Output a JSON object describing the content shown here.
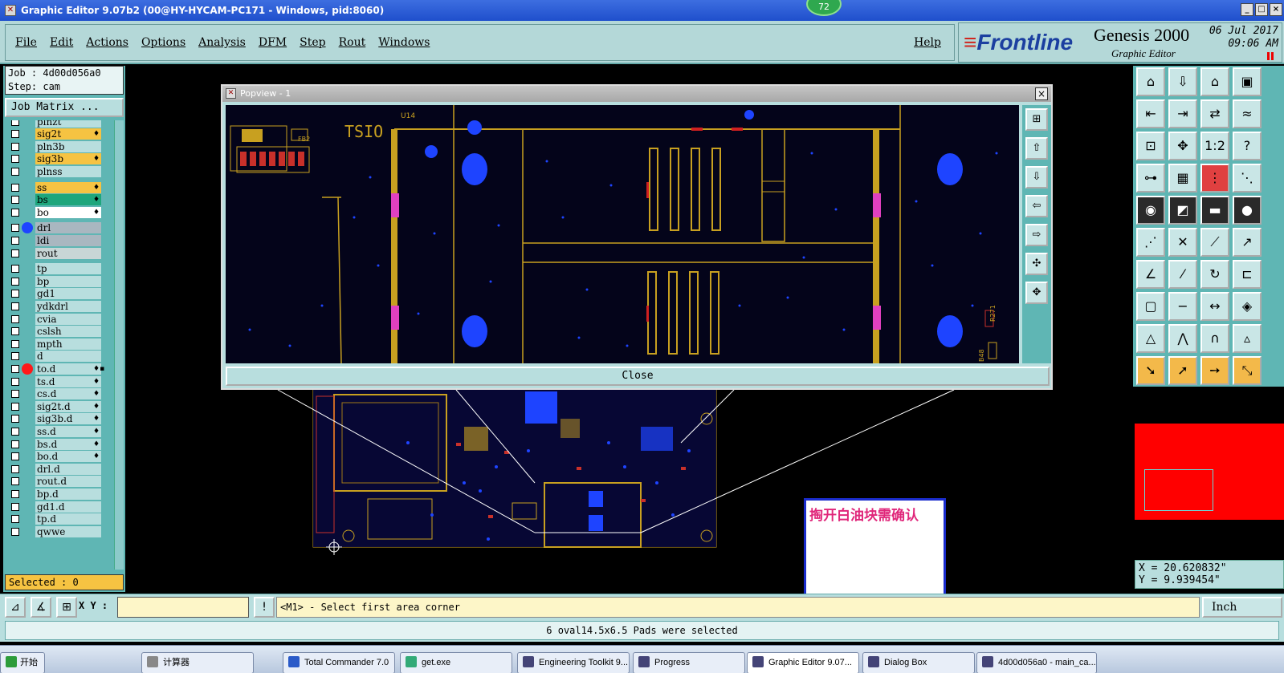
{
  "window": {
    "title": "Graphic Editor 9.07b2 (00@HY-HYCAM-PC171 - Windows, pid:8060)",
    "badge": "72",
    "controls": [
      "_",
      "□",
      "×"
    ]
  },
  "menu": {
    "items": [
      "File",
      "Edit",
      "Actions",
      "Options",
      "Analysis",
      "DFM",
      "Step",
      "Rout",
      "Windows"
    ],
    "help": "Help"
  },
  "brand": {
    "logo": "Frontline",
    "product": "Genesis 2000",
    "subtitle": "Graphic Editor",
    "date": "06 Jul 2017",
    "time": "09:06 AM"
  },
  "job": {
    "job_line": "Job : 4d00d056a0",
    "step_line": "Step: cam",
    "matrix_button": "Job Matrix ..."
  },
  "layers": [
    {
      "name": "plnzt",
      "color": "#b8dede",
      "mark": "",
      "dot": ""
    },
    {
      "name": "sig2t",
      "color": "#f6c342",
      "mark": "♦",
      "dot": ""
    },
    {
      "name": "pln3b",
      "color": "#b8dede",
      "mark": "",
      "dot": ""
    },
    {
      "name": "sig3b",
      "color": "#f6c342",
      "mark": "♦",
      "dot": ""
    },
    {
      "name": "plnss",
      "color": "#b8dede",
      "mark": "",
      "dot": ""
    },
    {
      "name": "ss",
      "color": "#f6c342",
      "mark": "♦",
      "dot": ""
    },
    {
      "name": "bs",
      "color": "#1ea67c",
      "mark": "♦",
      "dot": ""
    },
    {
      "name": "bo",
      "color": "#ffffff",
      "mark": "♦",
      "dot": ""
    },
    {
      "name": "drl",
      "color": "#a9b7c0",
      "mark": "",
      "dot": "#1e44ff"
    },
    {
      "name": "ldi",
      "color": "#a9b7c0",
      "mark": "",
      "dot": ""
    },
    {
      "name": "rout",
      "color": "#c8d6d6",
      "mark": "",
      "dot": ""
    },
    {
      "name": "tp",
      "color": "#b8dede",
      "mark": "",
      "dot": ""
    },
    {
      "name": "bp",
      "color": "#b8dede",
      "mark": "",
      "dot": ""
    },
    {
      "name": "gd1",
      "color": "#b8dede",
      "mark": "",
      "dot": ""
    },
    {
      "name": "ydkdrl",
      "color": "#b8dede",
      "mark": "",
      "dot": ""
    },
    {
      "name": "cvia",
      "color": "#b8dede",
      "mark": "",
      "dot": ""
    },
    {
      "name": "cslsh",
      "color": "#b8dede",
      "mark": "",
      "dot": ""
    },
    {
      "name": "mpth",
      "color": "#b8dede",
      "mark": "",
      "dot": ""
    },
    {
      "name": "d",
      "color": "#b8dede",
      "mark": "",
      "dot": ""
    },
    {
      "name": "to.d",
      "color": "#b8dede",
      "mark": "♦▪",
      "dot": "#ff1a1a"
    },
    {
      "name": "ts.d",
      "color": "#b8dede",
      "mark": "♦",
      "dot": ""
    },
    {
      "name": "cs.d",
      "color": "#b8dede",
      "mark": "♦",
      "dot": ""
    },
    {
      "name": "sig2t.d",
      "color": "#b8dede",
      "mark": "♦",
      "dot": ""
    },
    {
      "name": "sig3b.d",
      "color": "#b8dede",
      "mark": "♦",
      "dot": ""
    },
    {
      "name": "ss.d",
      "color": "#b8dede",
      "mark": "♦",
      "dot": ""
    },
    {
      "name": "bs.d",
      "color": "#b8dede",
      "mark": "♦",
      "dot": ""
    },
    {
      "name": "bo.d",
      "color": "#b8dede",
      "mark": "♦",
      "dot": ""
    },
    {
      "name": "drl.d",
      "color": "#b8dede",
      "mark": "",
      "dot": ""
    },
    {
      "name": "rout.d",
      "color": "#b8dede",
      "mark": "",
      "dot": ""
    },
    {
      "name": "bp.d",
      "color": "#b8dede",
      "mark": "",
      "dot": ""
    },
    {
      "name": "gd1.d",
      "color": "#b8dede",
      "mark": "",
      "dot": ""
    },
    {
      "name": "tp.d",
      "color": "#b8dede",
      "mark": "",
      "dot": ""
    },
    {
      "name": "qwwe",
      "color": "#b8dede",
      "mark": "",
      "dot": ""
    }
  ],
  "selected_label": "Selected : 0",
  "popview": {
    "title": "Popview - 1",
    "close_label": "Close",
    "board_labels": {
      "tsio": "TSIO",
      "u14": "U14",
      "fb2": "FB2",
      "r271": "R271",
      "b48": "B48"
    }
  },
  "note": {
    "text": "掏开白油块需确认"
  },
  "coords": {
    "x": "X = 20.620832\"",
    "y": "Y = 9.939454\""
  },
  "command": {
    "xy_label": "X Y :",
    "xy_value": "",
    "info_icon": "!",
    "prompt": "<M1> - Select first area corner",
    "units": "Inch"
  },
  "status": {
    "message": "6 oval14.5x6.5 Pads were selected"
  },
  "taskbar": {
    "start": "开始",
    "tasks": [
      "计算器",
      "Total Commander 7.0",
      "get.exe",
      "Engineering Toolkit 9...",
      "Progress",
      "Graphic Editor 9.07...",
      "Dialog Box",
      "4d00d056a0 - main_ca..."
    ]
  },
  "colors": {
    "panel_teal": "#5fb6b4",
    "light_teal": "#b8dede",
    "board_yellow": "#c8a020",
    "via_blue": "#1e44ff",
    "note_pink": "#e0267a"
  }
}
